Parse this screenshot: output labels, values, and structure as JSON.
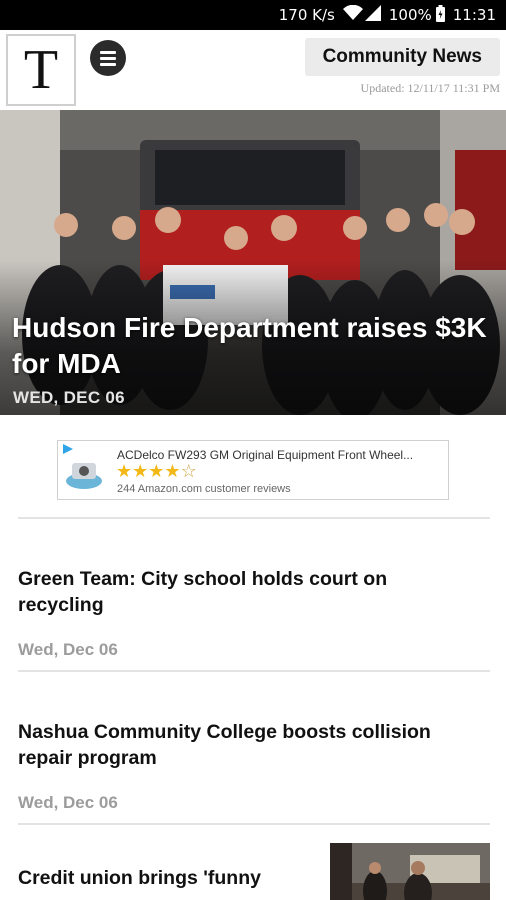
{
  "status_bar": {
    "speed": "170 K/s",
    "battery": "100%",
    "time": "11:31"
  },
  "header": {
    "logo_letter": "T",
    "section": "Community News",
    "updated": "Updated: 12/11/17 11:31 PM"
  },
  "hero": {
    "title": "Hudson Fire Department raises $3K for MDA",
    "date": "WED, DEC 06"
  },
  "ad": {
    "title": "ACDelco FW293 GM Original Equipment Front Wheel...",
    "rating": 4,
    "stars": "★★★★☆",
    "reviews": "244 Amazon.com customer reviews"
  },
  "articles": [
    {
      "title": "Green Team: City school holds court on recycling",
      "date": "Wed, Dec 06"
    },
    {
      "title": "Nashua Community College boosts collision repair program",
      "date": "Wed, Dec 06"
    },
    {
      "title": "Credit union brings 'funny",
      "date": ""
    }
  ],
  "colors": {
    "status_bar": "#000000",
    "section_pill": "#ebebeb",
    "text": "#111111",
    "muted": "#9c9c9c",
    "star": "#f1b817"
  }
}
